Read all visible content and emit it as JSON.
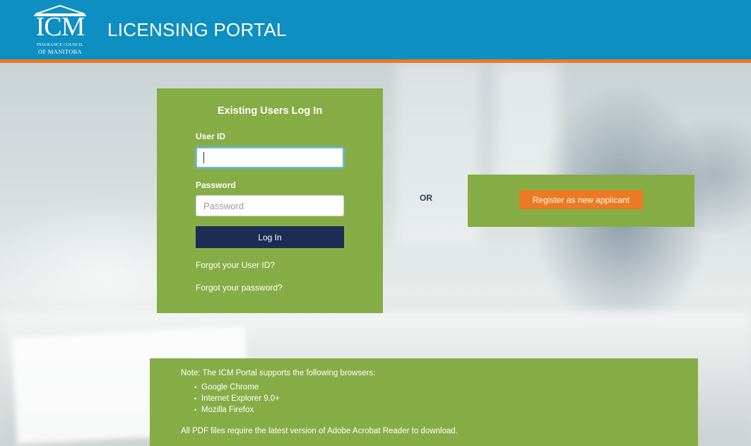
{
  "header": {
    "logo_mark": "ICM",
    "logo_line1": "INSURANCE COUNCIL",
    "logo_line2": "OF MANITOBA",
    "title": "LICENSING PORTAL"
  },
  "login": {
    "title": "Existing Users Log In",
    "userid_label": "User ID",
    "userid_value": "",
    "password_label": "Password",
    "password_placeholder": "Password",
    "login_button": "Log In",
    "forgot_userid": "Forgot your User ID?",
    "forgot_password": "Forgot your password?"
  },
  "or_label": "OR",
  "register": {
    "button": "Register as new applicant"
  },
  "note": {
    "label": "Note",
    "intro_text": ": The ICM Portal supports the following browsers:",
    "browsers": [
      "Google Chrome",
      "Internet Explorer 9.0+",
      "Mozilla Firefox"
    ],
    "footer": "All PDF files require the latest version of Adobe Acrobat Reader to download."
  },
  "colors": {
    "header_blue": "#0d8fc2",
    "accent_orange": "#ec7a22",
    "panel_green": "#86ad45",
    "button_navy": "#1b2c55"
  },
  "icons": {
    "logo_building": "building-pediment-icon"
  }
}
